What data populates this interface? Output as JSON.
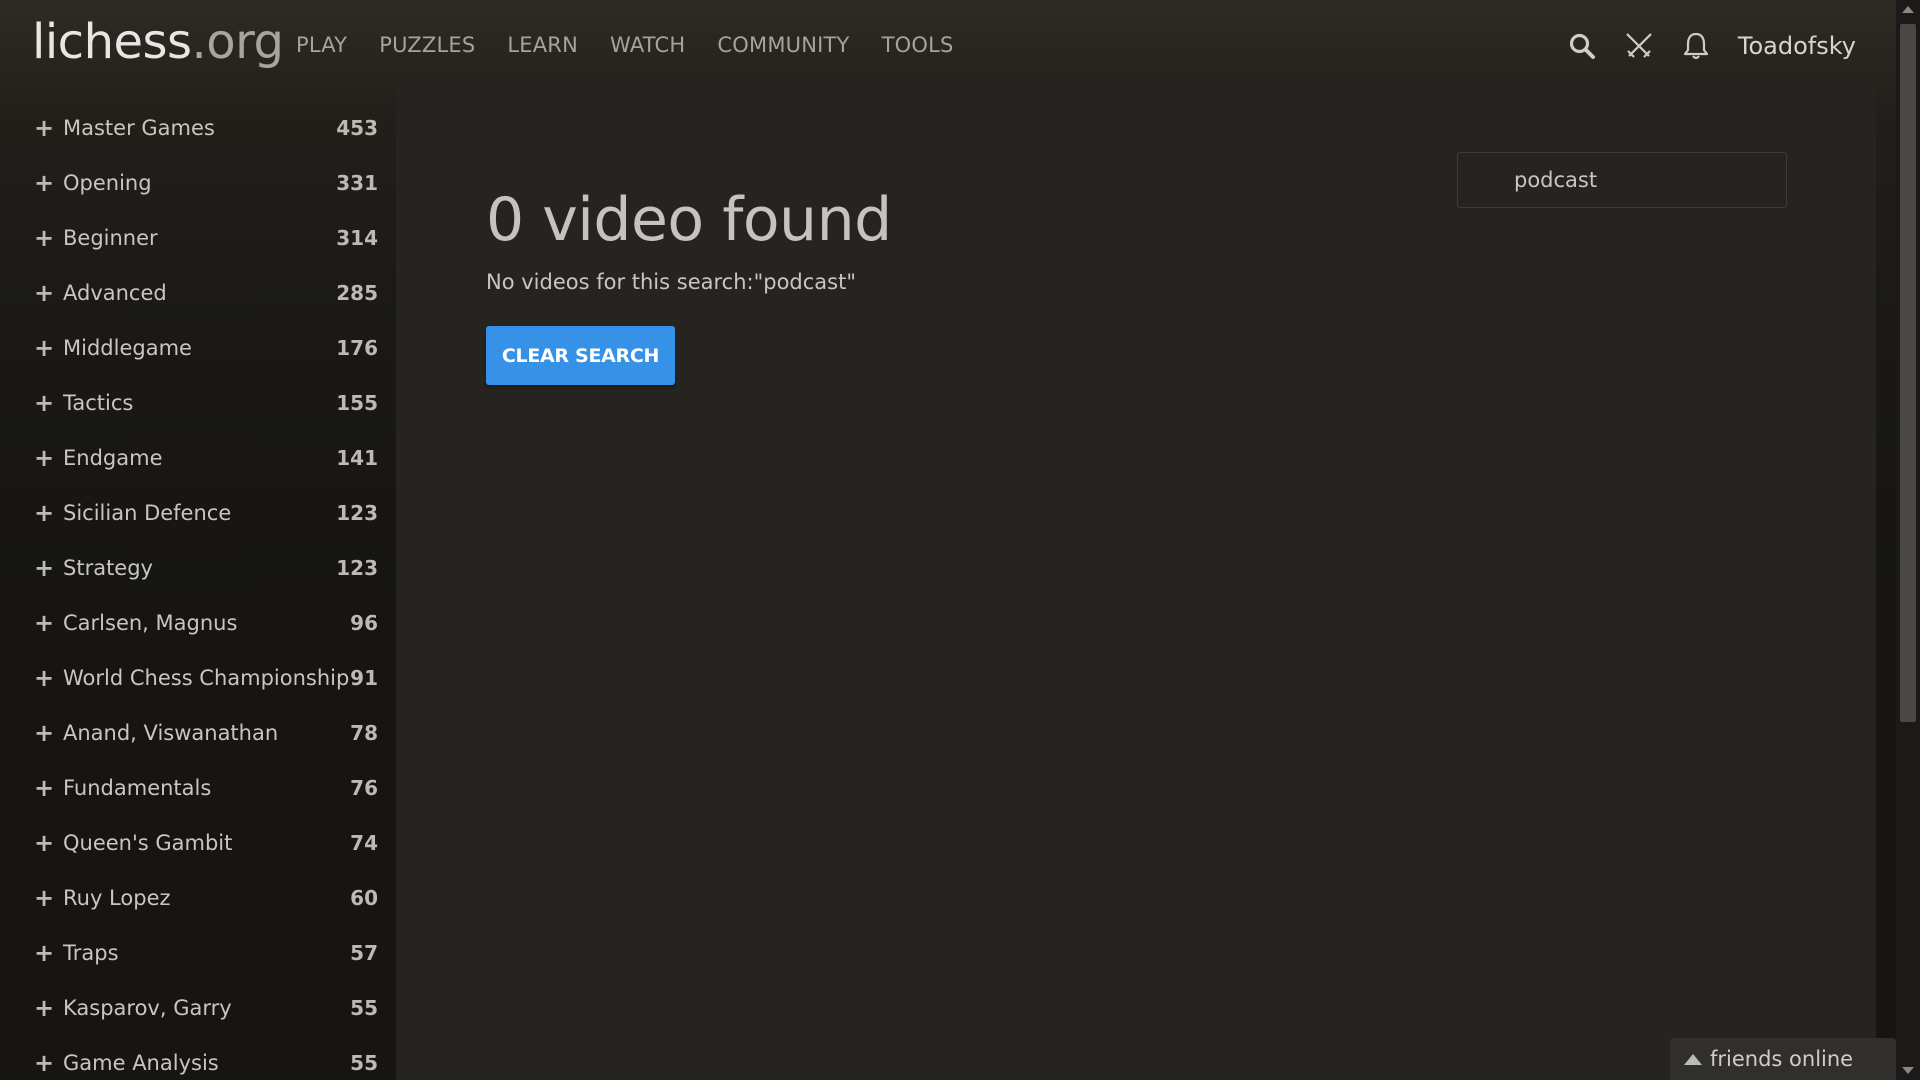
{
  "header": {
    "logo_main": "lichess",
    "logo_tld": ".org",
    "nav": [
      "PLAY",
      "PUZZLES",
      "LEARN",
      "WATCH",
      "COMMUNITY",
      "TOOLS"
    ],
    "icons": [
      "search-icon",
      "swords-icon",
      "bell-icon"
    ],
    "username": "Toadofsky"
  },
  "sidebar": {
    "items": [
      {
        "label": "Master Games",
        "count": "453"
      },
      {
        "label": "Opening",
        "count": "331"
      },
      {
        "label": "Beginner",
        "count": "314"
      },
      {
        "label": "Advanced",
        "count": "285"
      },
      {
        "label": "Middlegame",
        "count": "176"
      },
      {
        "label": "Tactics",
        "count": "155"
      },
      {
        "label": "Endgame",
        "count": "141"
      },
      {
        "label": "Sicilian Defence",
        "count": "123"
      },
      {
        "label": "Strategy",
        "count": "123"
      },
      {
        "label": "Carlsen, Magnus",
        "count": "96"
      },
      {
        "label": "World Chess Championship",
        "count": "91"
      },
      {
        "label": "Anand, Viswanathan",
        "count": "78"
      },
      {
        "label": "Fundamentals",
        "count": "76"
      },
      {
        "label": "Queen's Gambit",
        "count": "74"
      },
      {
        "label": "Ruy Lopez",
        "count": "60"
      },
      {
        "label": "Traps",
        "count": "57"
      },
      {
        "label": "Kasparov, Garry",
        "count": "55"
      },
      {
        "label": "Game Analysis",
        "count": "55"
      }
    ],
    "plus_glyph": "+"
  },
  "main": {
    "title": "0 video found",
    "search_value": "podcast",
    "no_results_text": "No videos for this search:\"podcast\"",
    "clear_button_label": "CLEAR SEARCH"
  },
  "friends": {
    "label": "friends online"
  },
  "colors": {
    "accent": "#3692e7",
    "panel": "#262421",
    "background": "#161512"
  }
}
